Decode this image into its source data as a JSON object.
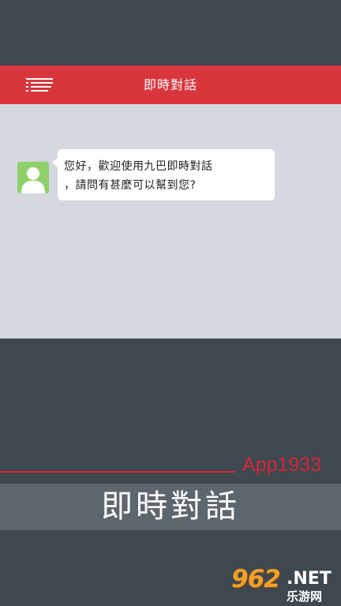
{
  "header": {
    "title": "即時對話",
    "menu_icon": "hamburger-menu-icon"
  },
  "chat": {
    "avatar_icon": "default-user-avatar-icon",
    "message_lines": [
      "您好，歡迎使用九巴即時對話",
      "，請問有甚麼可以幫到您?"
    ]
  },
  "promo": {
    "brand": "App1933",
    "banner_title": "即時對話"
  },
  "watermark": {
    "number": "962",
    "suffix": ".NET",
    "site_name": "乐游网"
  },
  "colors": {
    "header": "#d8363c",
    "chat_background": "#d6d8e0",
    "page_background": "#3f474f",
    "banner": "#5e666d",
    "brand_red": "#d0283a",
    "avatar_green": "#8fd06a"
  }
}
